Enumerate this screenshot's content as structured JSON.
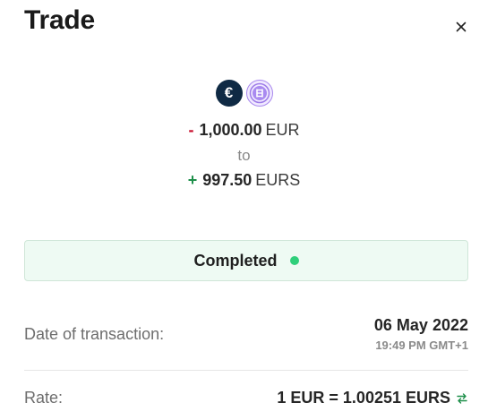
{
  "header": {
    "title": "Trade"
  },
  "trade": {
    "from": {
      "sign": "-",
      "amount": "1,000.00",
      "currency": "EUR"
    },
    "connector": "to",
    "to": {
      "sign": "+",
      "amount": "997.50",
      "currency": "EURS"
    }
  },
  "icons": {
    "from": "euro-coin-icon",
    "to": "eurs-coin-icon",
    "close": "close-icon",
    "swap": "swap-arrows-icon"
  },
  "status": {
    "label": "Completed",
    "color": "#2fcf7a"
  },
  "details": {
    "date_label": "Date of transaction:",
    "date": "06 May 2022",
    "time": "19:49 PM GMT+1",
    "rate_label": "Rate:",
    "rate_value": "1 EUR = 1.00251 EURS"
  },
  "colors": {
    "negative": "#c8102e",
    "positive": "#1e8f4a",
    "status_bg": "#eefaf3"
  }
}
